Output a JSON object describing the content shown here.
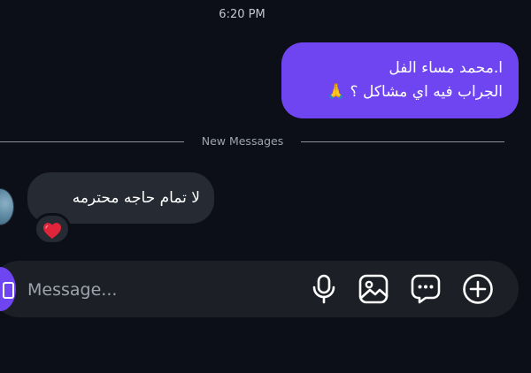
{
  "thread": {
    "timestamp": "6:20 PM",
    "outgoing_message": {
      "line1": "ا.محمد مساء الفل",
      "line2": "الجراب فيه اي مشاكل ؟ 🙏"
    },
    "divider_label": "New Messages",
    "incoming_message": {
      "text": "لا تمام حاجه محترمه",
      "reaction": "heart"
    }
  },
  "composer": {
    "placeholder": "Message...",
    "icons": [
      "microphone-icon",
      "image-icon",
      "chat-bubble-icon",
      "plus-icon"
    ]
  },
  "colors": {
    "background": "#0c0f17",
    "outgoing_bubble": "#6e45f0",
    "incoming_bubble": "#262a33",
    "composer": "#1c1f26",
    "reaction_heart": "#e0253b"
  }
}
